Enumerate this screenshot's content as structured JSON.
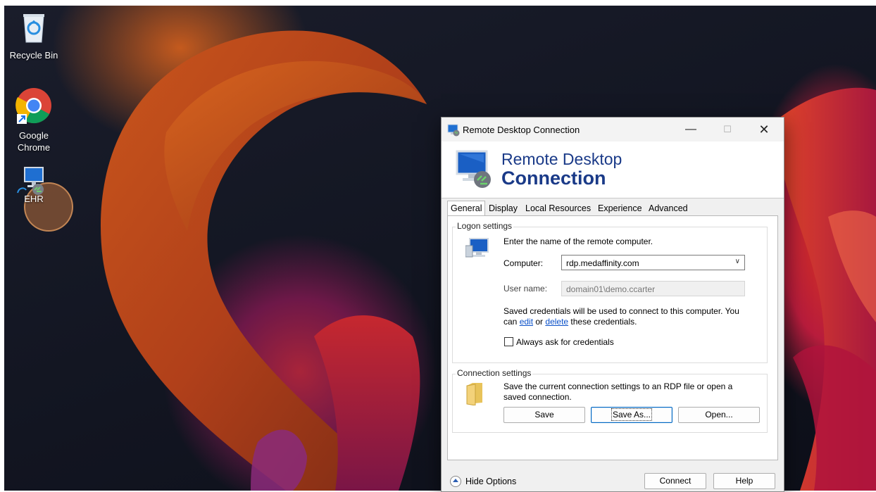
{
  "desktop": {
    "icons": [
      {
        "label": "Recycle Bin"
      },
      {
        "label": "Google Chrome"
      },
      {
        "label": "EHR"
      }
    ]
  },
  "dialog": {
    "title": "Remote Desktop Connection",
    "banner": {
      "line1": "Remote Desktop",
      "line2": "Connection"
    },
    "tabs": [
      "General",
      "Display",
      "Local Resources",
      "Experience",
      "Advanced"
    ],
    "active_tab": "General",
    "logon": {
      "group_title": "Logon settings",
      "instruction": "Enter the name of the remote computer.",
      "computer_label": "Computer:",
      "computer_value": "rdp.medaffinity.com",
      "username_label": "User name:",
      "username_value": "domain01\\demo.ccarter",
      "saved_text_1": "Saved credentials will be used to connect to this computer.  You",
      "saved_text_2a": "can ",
      "edit_link": "edit",
      "saved_text_2b": " or ",
      "delete_link": "delete",
      "saved_text_2c": " these credentials.",
      "always_ask_label": "Always ask for credentials",
      "always_ask_checked": false
    },
    "connection": {
      "group_title": "Connection settings",
      "text_1": "Save the current connection settings to an RDP file or open a",
      "text_2": "saved connection.",
      "save_label": "Save",
      "save_as_label": "Save As...",
      "open_label": "Open..."
    },
    "footer": {
      "hide_options_label": "Hide Options",
      "connect_label": "Connect",
      "help_label": "Help"
    }
  },
  "colors": {
    "banner_text": "#1a3a88",
    "link": "#0a50c8",
    "focus_border": "#0067c0"
  }
}
